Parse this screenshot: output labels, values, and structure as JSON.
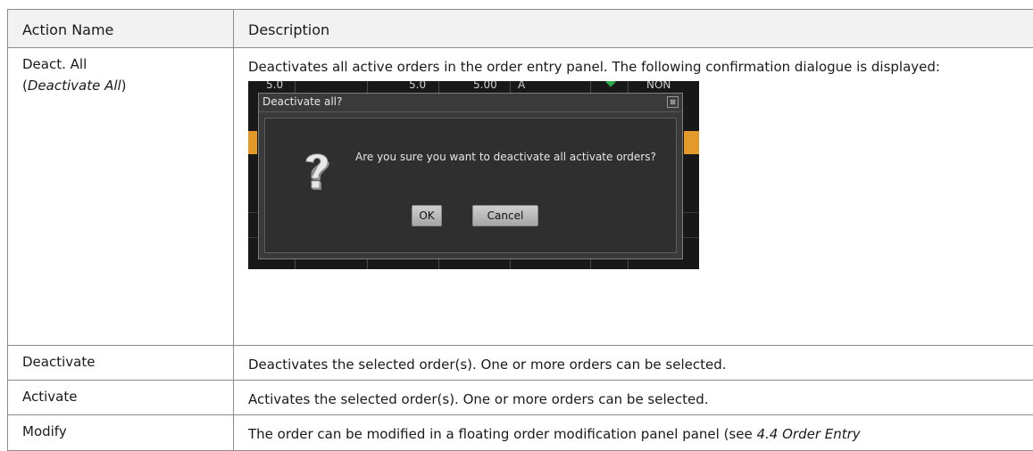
{
  "table": {
    "headers": [
      "Action Name",
      "Description"
    ],
    "rows": [
      {
        "name": "Deact. All",
        "name_sub_open": "(",
        "name_sub_italic": "Deactivate All",
        "name_sub_close": ")",
        "description": "Deactivates all active orders in the order entry panel. The following confirmation dialogue is displayed:"
      },
      {
        "name": "Deactivate",
        "description": "Deactivates the selected order(s). One or more orders can be selected."
      },
      {
        "name": "Activate",
        "description": "Activates the selected order(s). One or more orders can be selected."
      },
      {
        "name": "Modify",
        "description": "The order can be modified in a floating order modification panel panel (see ",
        "description_italic": "4.4 Order Entry"
      }
    ]
  },
  "dialog": {
    "title": "Deactivate all?",
    "close_glyph": "⊠",
    "message": "Are you sure you want to deactivate all activate orders?",
    "ok_label": "OK",
    "cancel_label": "Cancel",
    "icon": "question-mark-icon",
    "background_cells": [
      "5.0",
      "5.0",
      "5.00",
      "A",
      "NON"
    ]
  },
  "colors": {
    "header_bg": "#f2f2f2",
    "border": "#8c8c8c",
    "dialog_bg": "#3a3a3a",
    "accent_orange": "#e39a28",
    "accent_green": "#2aa84a"
  }
}
